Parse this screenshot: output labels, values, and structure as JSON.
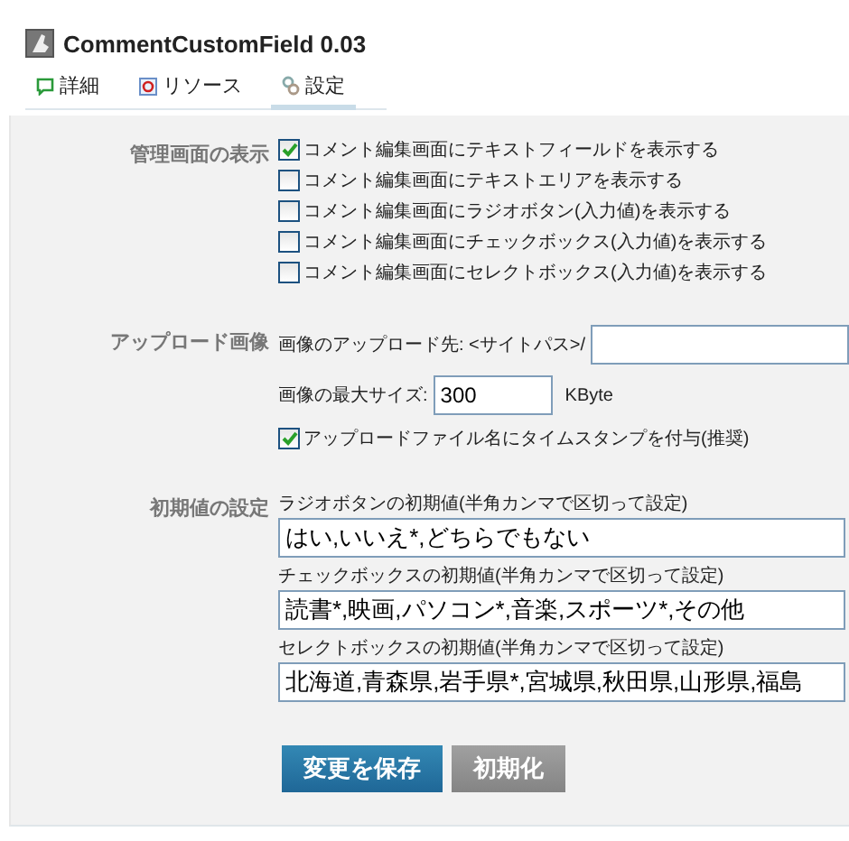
{
  "title": "CommentCustomField 0.03",
  "tabs": [
    {
      "label": "詳細",
      "kind": "detail",
      "selected": false
    },
    {
      "label": "リソース",
      "kind": "resource",
      "selected": false
    },
    {
      "label": "設定",
      "kind": "settings",
      "selected": true
    }
  ],
  "display_section": {
    "label": "管理画面の表示",
    "options": [
      {
        "label": "コメント編集画面にテキストフィールドを表示する",
        "checked": true
      },
      {
        "label": "コメント編集画面にテキストエリアを表示する",
        "checked": false
      },
      {
        "label": "コメント編集画面にラジオボタン(入力値)を表示する",
        "checked": false
      },
      {
        "label": "コメント編集画面にチェックボックス(入力値)を表示する",
        "checked": false
      },
      {
        "label": "コメント編集画面にセレクトボックス(入力値)を表示する",
        "checked": false
      }
    ]
  },
  "upload_section": {
    "label": "アップロード画像",
    "path_label": "画像のアップロード先: <サイトパス>/",
    "size_label": "画像の最大サイズ:",
    "size_value": "300",
    "size_unit": "KByte",
    "timestamp": {
      "label": "アップロードファイル名にタイムスタンプを付与(推奨)",
      "checked": true
    }
  },
  "defaults_section": {
    "label": "初期値の設定",
    "fields": [
      {
        "label": "ラジオボタンの初期値(半角カンマで区切って設定)",
        "value": "はい,いいえ*,どちらでもない"
      },
      {
        "label": "チェックボックスの初期値(半角カンマで区切って設定)",
        "value": "読書*,映画,パソコン*,音楽,スポーツ*,その他"
      },
      {
        "label": "セレクトボックスの初期値(半角カンマで区切って設定)",
        "value": "北海道,青森県,岩手県*,宮城県,秋田県,山形県,福島"
      }
    ]
  },
  "buttons": [
    {
      "label": "変更を保存",
      "kind": "primary"
    },
    {
      "label": "初期化",
      "kind": "secondary"
    }
  ]
}
